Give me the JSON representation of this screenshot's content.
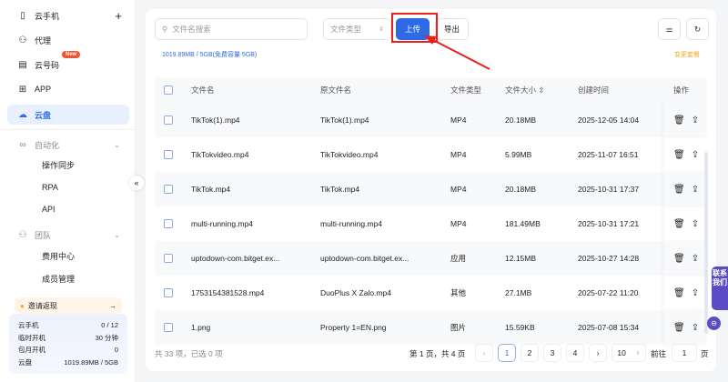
{
  "sidebar": {
    "items": [
      {
        "label": "云手机",
        "icon": "phone-icon"
      },
      {
        "label": "代理",
        "icon": "network-icon"
      },
      {
        "label": "云号码",
        "icon": "sim-icon",
        "badge": "New"
      },
      {
        "label": "APP",
        "icon": "grid-icon"
      },
      {
        "label": "云盘",
        "icon": "cloud-icon",
        "active": true
      }
    ],
    "groups": [
      {
        "label": "自动化",
        "icon": "infinity-icon",
        "children": [
          {
            "label": "操作同步"
          },
          {
            "label": "RPA"
          },
          {
            "label": "API"
          }
        ]
      },
      {
        "label": "团队",
        "icon": "team-icon",
        "children": [
          {
            "label": "费用中心"
          },
          {
            "label": "成员管理"
          }
        ]
      }
    ],
    "invite": "邀请返现",
    "quota": [
      {
        "label": "云手机",
        "value": "0 / 12"
      },
      {
        "label": "临时开机",
        "value": "30 分钟"
      },
      {
        "label": "包月开机",
        "value": "0"
      },
      {
        "label": "云盘",
        "value": "1019.89MB / 5GB"
      }
    ]
  },
  "toolbar": {
    "search_placeholder": "文件名搜索",
    "type_placeholder": "文件类型",
    "upload": "上传",
    "export": "导出"
  },
  "info": {
    "usage": "1019.89MB / 5GB(免费容量 5GB)",
    "change_plan": "变更套餐"
  },
  "table": {
    "headers": [
      "文件名",
      "原文件名",
      "文件类型",
      "文件大小",
      "创建时间",
      "操作"
    ],
    "rows": [
      [
        "TikTok(1).mp4",
        "TikTok(1).mp4",
        "MP4",
        "20.18MB",
        "2025-12-05 14:04"
      ],
      [
        "TikTokvideo.mp4",
        "TikTokvideo.mp4",
        "MP4",
        "5.99MB",
        "2025-11-07 16:51"
      ],
      [
        "TikTok.mp4",
        "TikTok.mp4",
        "MP4",
        "20.18MB",
        "2025-10-31 17:37"
      ],
      [
        "multi-running.mp4",
        "multi-running.mp4",
        "MP4",
        "181.49MB",
        "2025-10-31 17:21"
      ],
      [
        "uptodown-com.bitget.ex...",
        "uptodown-com.bitget.ex...",
        "应用",
        "12.15MB",
        "2025-10-27 14:28"
      ],
      [
        "1753154381528.mp4",
        "DuoPlus X Zalo.mp4",
        "其他",
        "27.1MB",
        "2025-07-22 11:20"
      ],
      [
        "1.png",
        "Property 1=EN.png",
        "图片",
        "15.59KB",
        "2025-07-08 15:34"
      ]
    ]
  },
  "footer": {
    "summary": "共 33 项，已选 0 项",
    "page_info": "第 1 页，共 4 页",
    "pages": [
      "1",
      "2",
      "3",
      "4"
    ],
    "current_page": 1,
    "page_size": "10",
    "goto_label": "前往",
    "goto_value": "1",
    "page_suffix": "页"
  },
  "contact": "联系我们",
  "colors": {
    "primary": "#2e6ae6",
    "highlight": "#e8211a",
    "accent": "#f5a623"
  }
}
